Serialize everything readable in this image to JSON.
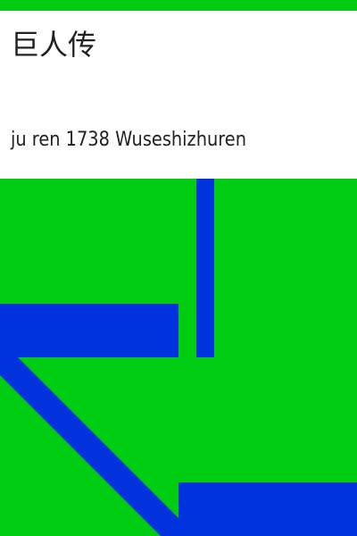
{
  "book": {
    "title": "巨人传",
    "author_line": "ju ren 1738 Wuseshizhuren"
  },
  "colors": {
    "background": "#00cc11",
    "accent": "#0033dd",
    "panel": "#ffffff",
    "text": "#222222"
  }
}
